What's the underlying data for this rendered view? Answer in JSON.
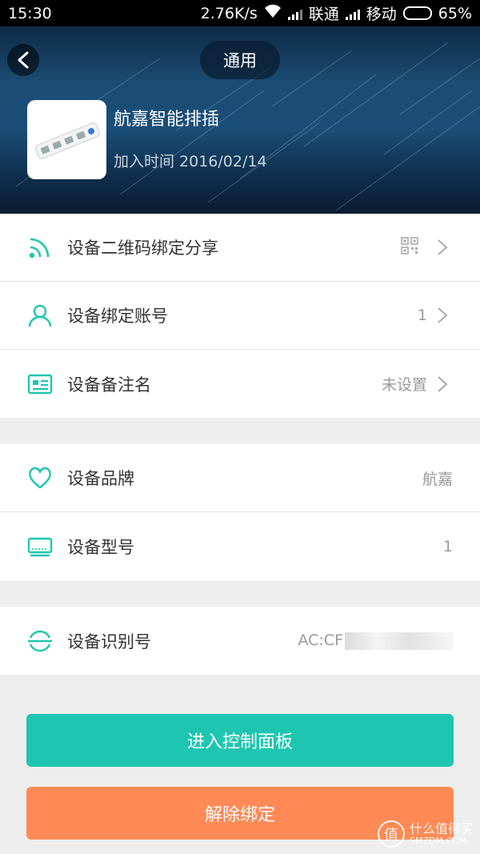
{
  "status_bar": {
    "time": "15:30",
    "speed": "2.76K/s",
    "carrier1": "联通",
    "carrier2": "移动",
    "battery": "65%"
  },
  "header": {
    "title": "通用",
    "device_name": "航嘉智能排插",
    "added_time": "加入时间 2016/02/14"
  },
  "group1": [
    {
      "label": "设备二维码绑定分享",
      "value": "",
      "icon": "wifi-share-icon",
      "trailing_icon": "qr-code-icon"
    },
    {
      "label": "设备绑定账号",
      "value": "1",
      "icon": "user-icon"
    },
    {
      "label": "设备备注名",
      "value": "未设置",
      "icon": "id-card-icon"
    }
  ],
  "group2": [
    {
      "label": "设备品牌",
      "value": "航嘉",
      "icon": "heart-icon"
    },
    {
      "label": "设备型号",
      "value": "1",
      "icon": "monitor-icon"
    }
  ],
  "group3": [
    {
      "label": "设备识别号",
      "value": "AC:CF",
      "icon": "identifier-icon"
    }
  ],
  "buttons": {
    "enter_panel": "进入控制面板",
    "unbind": "解除绑定"
  },
  "watermark": {
    "glyph": "值",
    "line1": "什么值得买",
    "line2": "SMZDM.COM"
  },
  "colors": {
    "accent": "#1ec6b1",
    "danger": "#ff8a55"
  }
}
